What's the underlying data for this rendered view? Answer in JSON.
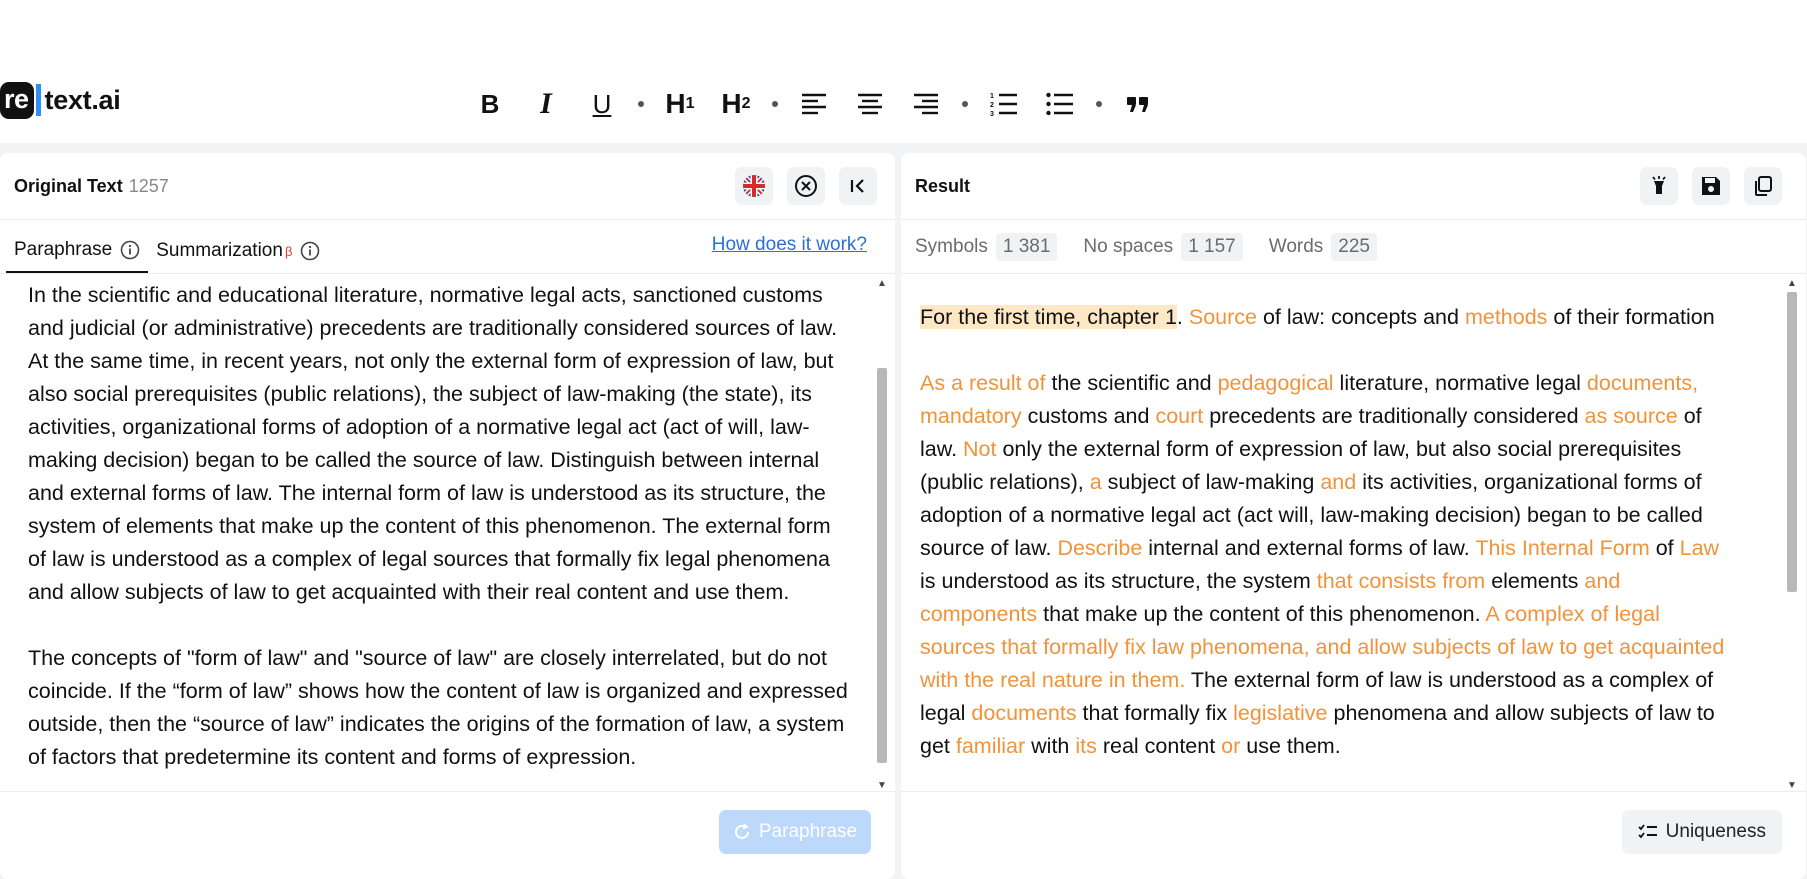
{
  "brand": {
    "prefix": "re",
    "name": "text.ai"
  },
  "toolbar": {
    "bold": "B",
    "italic": "I",
    "underline": "U",
    "h1": "H",
    "h1_sub": "1",
    "h2": "H",
    "h2_sub": "2"
  },
  "left": {
    "title": "Original Text",
    "count": "1257",
    "tabs": {
      "paraphrase": "Paraphrase",
      "summarization": "Summarization",
      "summarization_badge": "β"
    },
    "how_link": "How does it work?",
    "paragraphs": [
      "In the scientific and educational literature, normative legal acts, sanctioned customs and judicial (or administrative) precedents are traditionally considered sources of law. At the same time, in recent years, not only the external form of expression of law, but also social prerequisites (public relations), the subject of law-making (the state), its activities, organizational forms of adoption of a normative legal act (act of will, law-making decision) began to be called the source of law. Distinguish between internal and external forms of law. The internal form of law is understood as its structure, the system of elements that make up the content of this phenomenon. The external form of law is understood as a complex of legal sources that formally fix legal phenomena and allow subjects of law to get acquainted with their real content and use them.",
      "The concepts of \"form of law\" and \"source of law\" are closely interrelated, but do not coincide. If the “form of law” shows how the content of law is organized and expressed outside, then the “source of law” indicates the origins of the formation of law, a system of factors that predetermine its content and forms of expression."
    ],
    "paraphrase_button": "Paraphrase"
  },
  "right": {
    "title": "Result",
    "stats": [
      {
        "label": "Symbols",
        "value": "1 381"
      },
      {
        "label": "No spaces",
        "value": "1 157"
      },
      {
        "label": "Words",
        "value": "225"
      }
    ],
    "paragraphs": [
      [
        {
          "t": "For the first time, chapter 1",
          "c": "hl"
        },
        {
          "t": ". "
        },
        {
          "t": "Source",
          "c": "o"
        },
        {
          "t": " of law: concepts and "
        },
        {
          "t": "methods",
          "c": "o"
        },
        {
          "t": " of their formation"
        }
      ],
      [
        {
          "t": "As a result of",
          "c": "o"
        },
        {
          "t": " the scientific and "
        },
        {
          "t": "pedagogical",
          "c": "o"
        },
        {
          "t": " literature, normative legal "
        },
        {
          "t": "documents, mandatory",
          "c": "o"
        },
        {
          "t": " customs and "
        },
        {
          "t": "court",
          "c": "o"
        },
        {
          "t": " precedents are traditionally considered "
        },
        {
          "t": "as source",
          "c": "o"
        },
        {
          "t": " of law. "
        },
        {
          "t": "Not",
          "c": "o"
        },
        {
          "t": " only the external form of expression of law, but also social prerequisites (public relations), "
        },
        {
          "t": "a",
          "c": "o"
        },
        {
          "t": " subject of law-making "
        },
        {
          "t": "and",
          "c": "o"
        },
        {
          "t": " its activities, organizational forms of adoption of a normative legal act (act will, law-making decision) began to be called source of law. "
        },
        {
          "t": "Describe",
          "c": "o"
        },
        {
          "t": " internal and external forms of law. "
        },
        {
          "t": "This Internal Form",
          "c": "o"
        },
        {
          "t": " of "
        },
        {
          "t": "Law",
          "c": "o"
        },
        {
          "t": " is understood as its structure, the system "
        },
        {
          "t": "that consists from",
          "c": "o"
        },
        {
          "t": " elements "
        },
        {
          "t": "and components",
          "c": "o"
        },
        {
          "t": " that make up the content of this phenomenon. "
        },
        {
          "t": "A complex of legal sources that formally fix law phenomena, and allow subjects of law to get acquainted with the real nature in them.",
          "c": "o"
        },
        {
          "t": " The external form of law is understood as a complex of legal "
        },
        {
          "t": "documents",
          "c": "o"
        },
        {
          "t": " that formally fix "
        },
        {
          "t": "legislative",
          "c": "o"
        },
        {
          "t": " phenomena and allow subjects of law to get "
        },
        {
          "t": "familiar",
          "c": "o"
        },
        {
          "t": " with "
        },
        {
          "t": "its",
          "c": "o"
        },
        {
          "t": " real content "
        },
        {
          "t": "or",
          "c": "o"
        },
        {
          "t": " use them."
        }
      ]
    ],
    "uniqueness_button": "Uniqueness"
  },
  "colors": {
    "accent_orange": "#f0933a",
    "link_blue": "#2a6fd6",
    "button_disabled": "#bcd8fb"
  }
}
